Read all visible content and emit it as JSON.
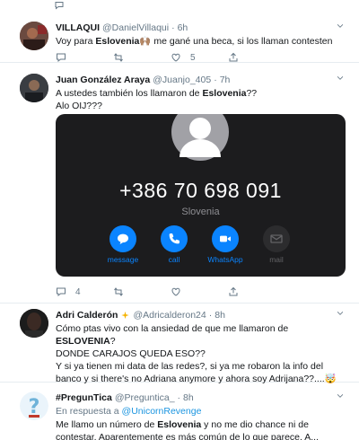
{
  "colors": {
    "accent": "#1b95e0",
    "phone_bg": "#1c1c1e",
    "ios_blue": "#0a84ff",
    "muted": "#657786"
  },
  "top_actions": {
    "reply": "",
    "retweet": "",
    "like": ""
  },
  "tweets": [
    {
      "name": "VILLAQUI",
      "handle": "@DanielVillaqui",
      "time": "6h",
      "text_pre": "Voy para ",
      "text_bold": "Eslovenia",
      "text_post": "🙌🏽 me gané una beca, si los llaman contesten",
      "reply_count": "",
      "retweet_count": "",
      "like_count": "5"
    },
    {
      "name": "Juan González Araya",
      "handle": "@Juanjo_405",
      "time": "7h",
      "line1_pre": "A ustedes también los llamaron de ",
      "line1_bold": "Eslovenia",
      "line1_post": "??",
      "line2": "Alo OIJ???",
      "phone": {
        "number": "+386 70 698 091",
        "country": "Slovenia",
        "buttons": [
          {
            "label": "message",
            "icon": "message-icon"
          },
          {
            "label": "call",
            "icon": "phone-icon"
          },
          {
            "label": "WhatsApp",
            "icon": "video-icon"
          },
          {
            "label": "mail",
            "icon": "mail-icon"
          }
        ]
      },
      "reply_count": "4",
      "retweet_count": "",
      "like_count": ""
    },
    {
      "name": "Adri Calderón",
      "handle": "@Adricalderon24",
      "time": "8h",
      "line1_pre": "Cómo ptas vivo con la ansiedad de que me llamaron de ",
      "line1_bold": "ESLOVENIA",
      "line1_post": "?",
      "line2": "DONDE CARAJOS QUEDA ESO??",
      "line3": "Y si ya tienen mi data de las redes?, si ya me robaron la info del banco y si there's no Adriana anymore y ahora soy Adrijana??....🤯"
    },
    {
      "name": "#PregunTica",
      "handle": "@Preguntica_",
      "time": "8h",
      "reply_prefix": "En respuesta a ",
      "reply_handle": "@UnicornRevenge",
      "text_pre": "Me llamo un número de ",
      "text_bold": "Eslovenia",
      "text_post": " y no me dio chance ni de contestar. Aparentemente es más común de lo que parece. A..."
    }
  ]
}
